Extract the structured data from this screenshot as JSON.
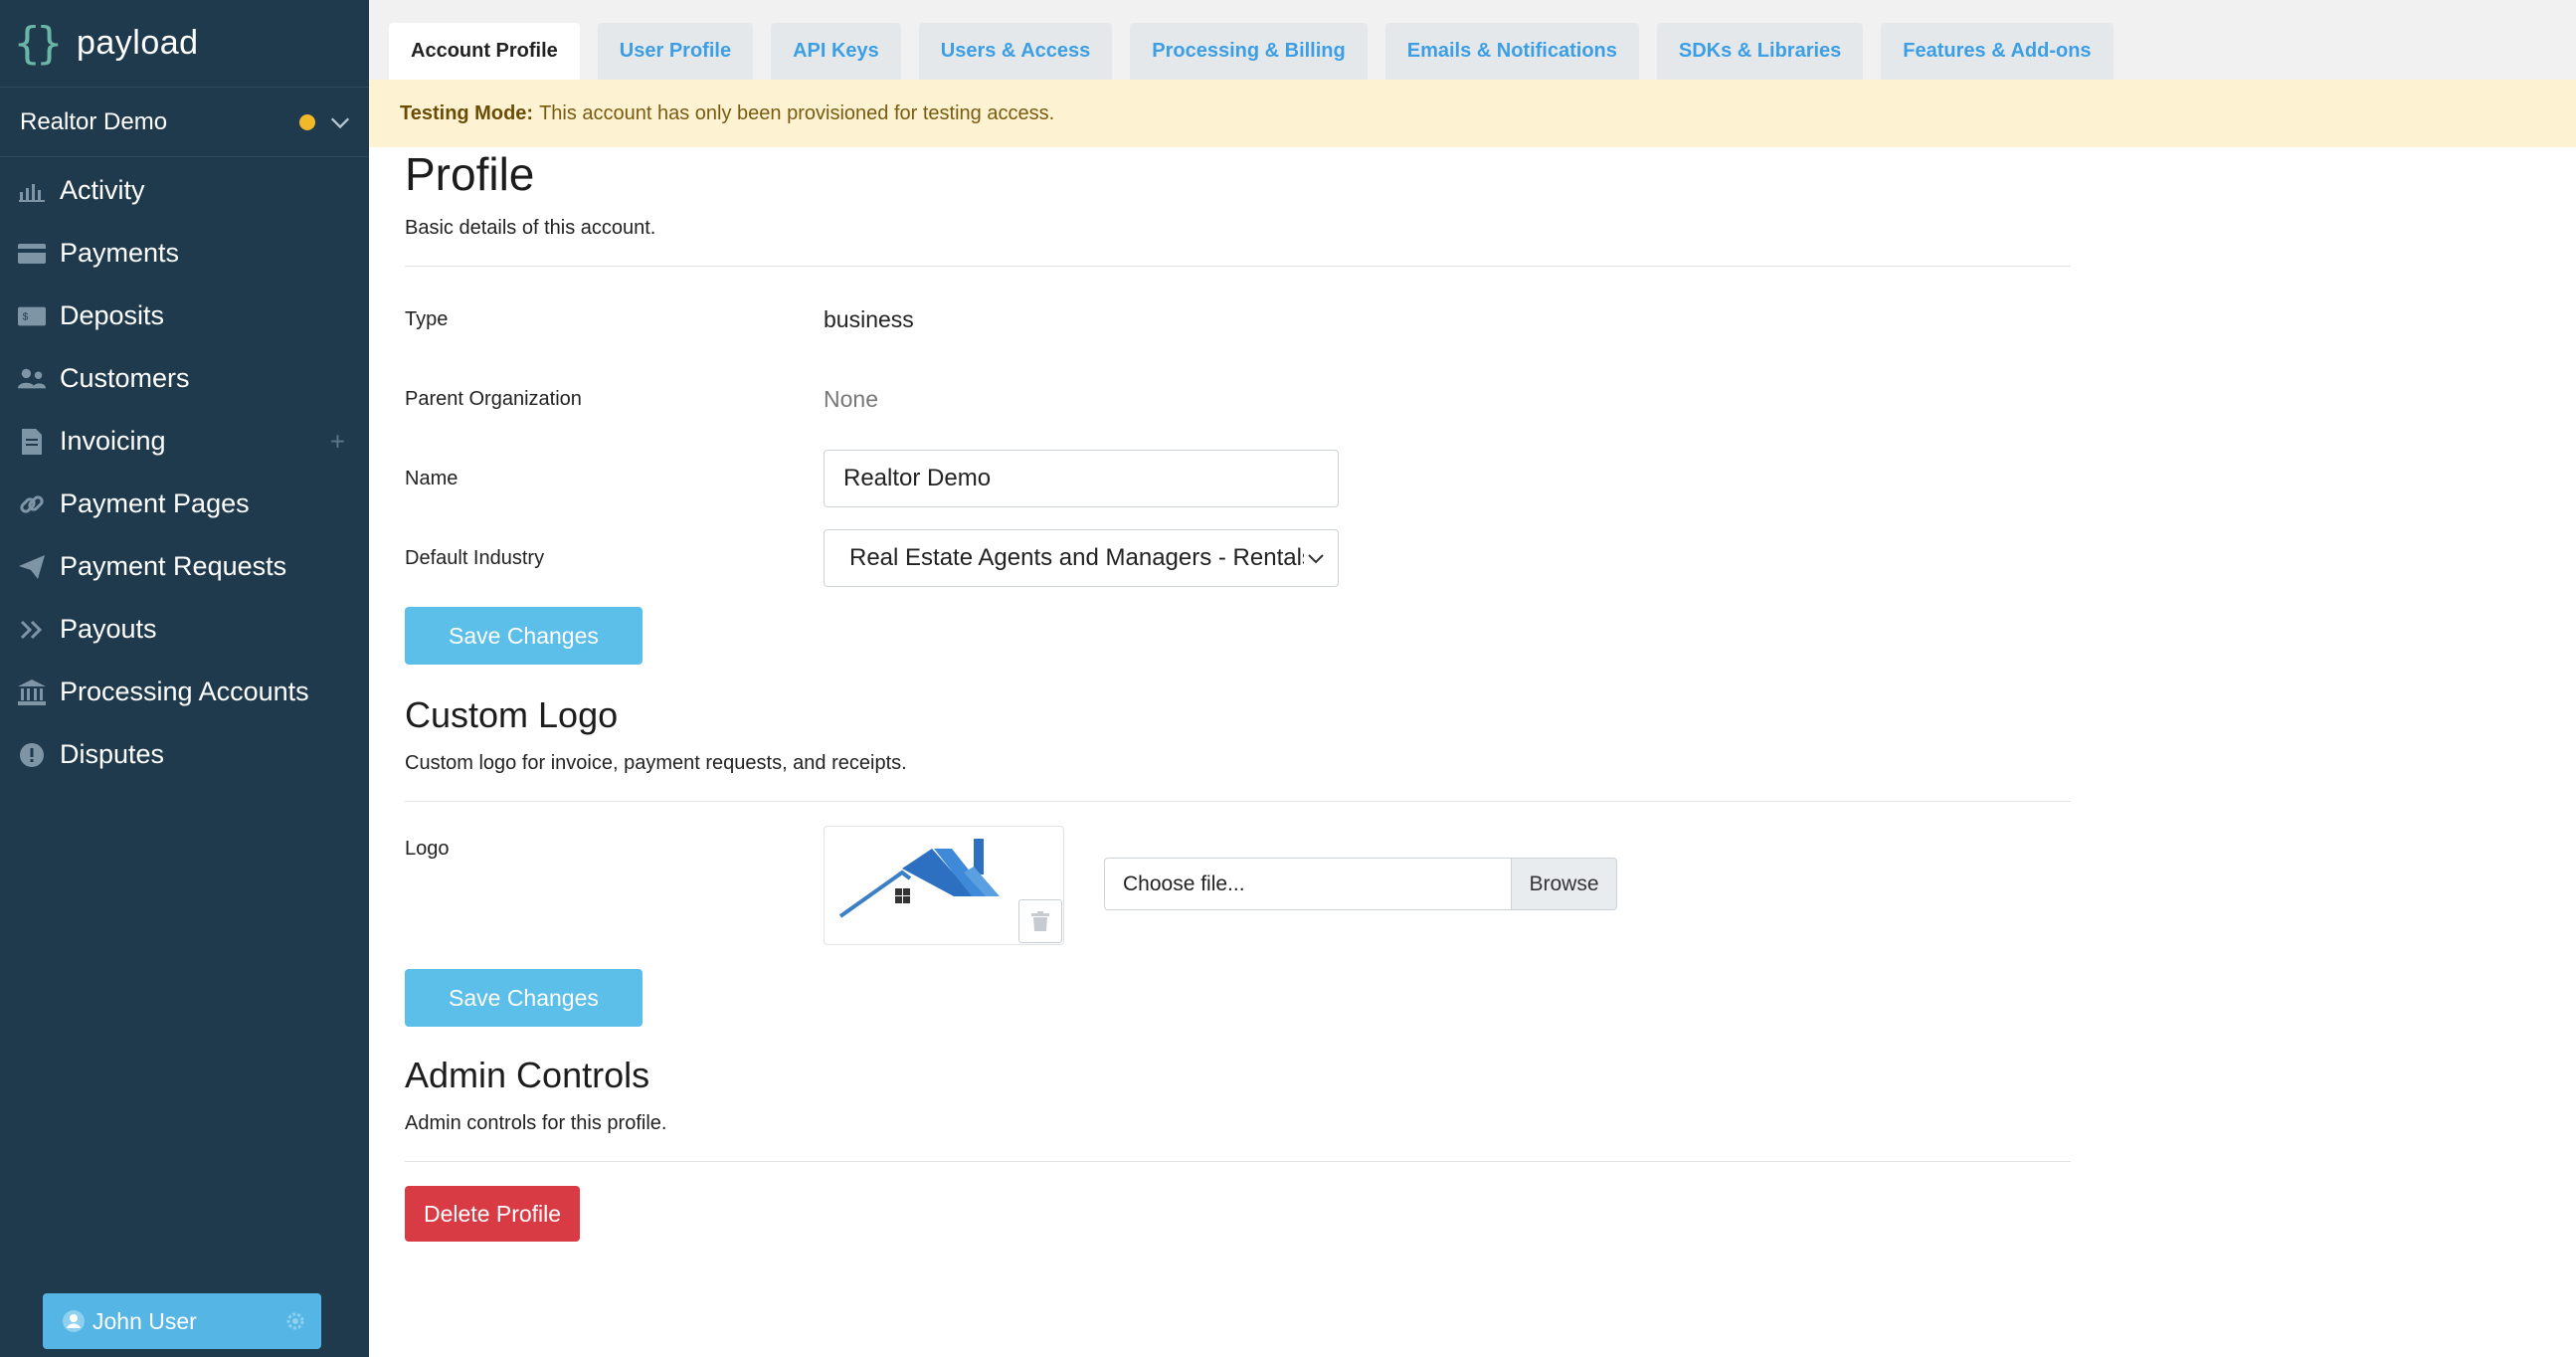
{
  "brand": {
    "name": "payload",
    "mark": "{}"
  },
  "account": {
    "name": "Realtor Demo",
    "status_color": "#f0b92a"
  },
  "sidebar": {
    "items": [
      {
        "label": "Activity",
        "icon": "bar-chart-icon"
      },
      {
        "label": "Payments",
        "icon": "credit-card-icon"
      },
      {
        "label": "Deposits",
        "icon": "cash-icon"
      },
      {
        "label": "Customers",
        "icon": "users-icon"
      },
      {
        "label": "Invoicing",
        "icon": "document-icon",
        "add": "+"
      },
      {
        "label": "Payment Pages",
        "icon": "link-icon"
      },
      {
        "label": "Payment Requests",
        "icon": "paper-plane-icon"
      },
      {
        "label": "Payouts",
        "icon": "double-chevron-right-icon"
      },
      {
        "label": "Processing Accounts",
        "icon": "bank-icon"
      },
      {
        "label": "Disputes",
        "icon": "exclamation-circle-icon"
      }
    ]
  },
  "user": {
    "name": "John User"
  },
  "tabs": [
    {
      "label": "Account Profile",
      "active": true
    },
    {
      "label": "User Profile"
    },
    {
      "label": "API Keys"
    },
    {
      "label": "Users & Access"
    },
    {
      "label": "Processing & Billing"
    },
    {
      "label": "Emails & Notifications"
    },
    {
      "label": "SDKs & Libraries"
    },
    {
      "label": "Features & Add-ons"
    }
  ],
  "banner": {
    "title": "Testing Mode:",
    "text": "This account has only been provisioned for testing access."
  },
  "profile": {
    "title": "Profile",
    "subtitle": "Basic details of this account.",
    "type_label": "Type",
    "type_value": "business",
    "parent_label": "Parent Organization",
    "parent_value": "None",
    "name_label": "Name",
    "name_value": "Realtor Demo",
    "industry_label": "Default Industry",
    "industry_value": "Real Estate Agents and Managers - Rentals",
    "save_label": "Save Changes"
  },
  "custom_logo": {
    "title": "Custom Logo",
    "subtitle": "Custom logo for invoice, payment requests, and receipts.",
    "logo_label": "Logo",
    "file_placeholder": "Choose file...",
    "browse_label": "Browse",
    "save_label": "Save Changes"
  },
  "admin": {
    "title": "Admin Controls",
    "subtitle": "Admin controls for this profile.",
    "delete_label": "Delete Profile"
  },
  "colors": {
    "sidebar": "#1f3a4d",
    "accent": "#5bbfe9",
    "danger": "#d93b44",
    "banner": "#fdf3d3"
  }
}
